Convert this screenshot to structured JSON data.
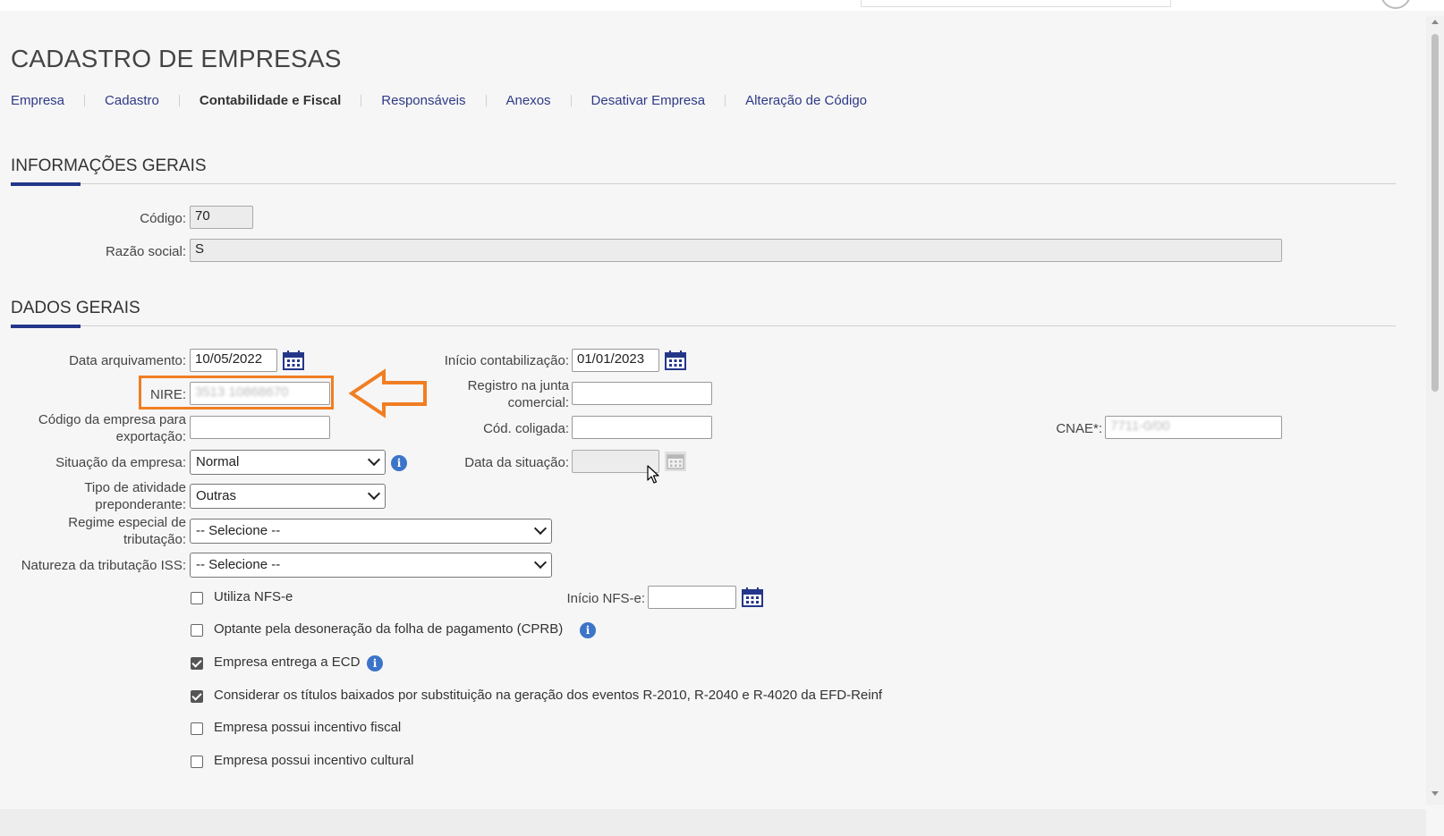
{
  "page": {
    "title": "CADASTRO DE EMPRESAS"
  },
  "tabs": [
    {
      "label": "Empresa"
    },
    {
      "label": "Cadastro"
    },
    {
      "label": "Contabilidade e Fiscal"
    },
    {
      "label": "Responsáveis"
    },
    {
      "label": "Anexos"
    },
    {
      "label": "Desativar Empresa"
    },
    {
      "label": "Alteração de Código"
    }
  ],
  "info_gerais": {
    "title": "INFORMAÇÕES GERAIS",
    "codigo_label": "Código:",
    "codigo_value": "70",
    "razao_label": "Razão social:",
    "razao_value": "S"
  },
  "dados_gerais": {
    "title": "DADOS GERAIS",
    "data_arquivamento_label": "Data arquivamento:",
    "data_arquivamento_value": "10/05/2022",
    "inicio_contabilizacao_label": "Início contabilização:",
    "inicio_contabilizacao_value": "01/01/2023",
    "nire_label": "NIRE:",
    "nire_value": "3513 10868670",
    "registro_junta_label_1": "Registro na junta",
    "registro_junta_label_2": "comercial:",
    "codigo_exportacao_label_1": "Código da empresa para",
    "codigo_exportacao_label_2": "exportação:",
    "cod_coligada_label": "Cód. coligada:",
    "cnae_label": "CNAE*:",
    "cnae_value": "7711-0/00",
    "situacao_label": "Situação da empresa:",
    "situacao_value": "Normal",
    "data_situacao_label": "Data da situação:",
    "tipo_atividade_label_1": "Tipo de atividade",
    "tipo_atividade_label_2": "preponderante:",
    "tipo_atividade_value": "Outras",
    "regime_label_1": "Regime especial de",
    "regime_label_2": "tributação:",
    "regime_value": "-- Selecione --",
    "natureza_label": "Natureza da tributação ISS:",
    "natureza_value": "-- Selecione --",
    "inicio_nfse_label": "Início NFS-e:"
  },
  "checkboxes": [
    {
      "label": "Utiliza NFS-e",
      "checked": false
    },
    {
      "label": "Optante pela desoneração da folha de pagamento (CPRB)",
      "checked": false
    },
    {
      "label": "Empresa entrega a ECD",
      "checked": true
    },
    {
      "label": "Considerar os títulos baixados por substituição na geração dos eventos R-2010, R-2040 e R-4020 da EFD-Reinf",
      "checked": true
    },
    {
      "label": "Empresa possui incentivo fiscal",
      "checked": false
    },
    {
      "label": "Empresa possui incentivo cultural",
      "checked": false
    }
  ],
  "icons": {
    "calendar": "calendar-icon",
    "info": "info-icon",
    "info_glyph": "i",
    "arrow_annotation": "left-arrow-annotation-icon"
  },
  "colors": {
    "accent": "#243689",
    "link": "#2e3a87",
    "highlight": "#f07e23",
    "info": "#3c74c9"
  }
}
